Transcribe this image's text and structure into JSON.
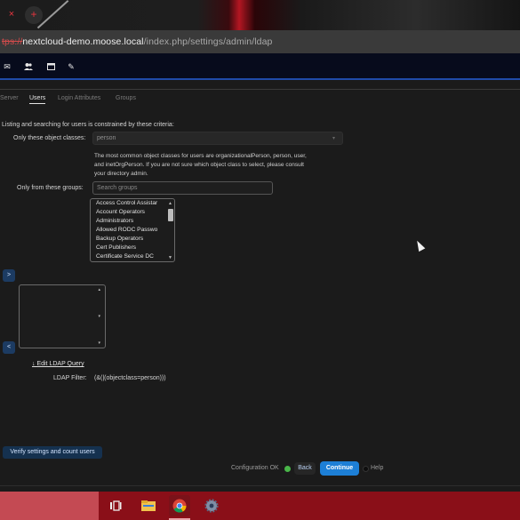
{
  "browser": {
    "url_scheme": "tps://",
    "url_host": "nextcloud-demo.moose.local",
    "url_path": "/index.php/settings/admin/ldap",
    "close_tab_glyph": "×",
    "new_tab_glyph": "+"
  },
  "header_icons": [
    "mail-icon",
    "contacts-icon",
    "calendar-icon",
    "pencil-icon"
  ],
  "tabs": [
    "Server",
    "Users",
    "Login Attributes",
    "Groups"
  ],
  "info_text": "Listing and searching for users is constrained by these criteria:",
  "object_classes": {
    "label": "Only these object classes:",
    "value": "person",
    "hint": "The most common object classes for users are organizationalPerson, person, user, and inetOrgPerson. If you are not sure which object class to select, please consult your directory admin."
  },
  "groups": {
    "label": "Only from these groups:",
    "search_placeholder": "Search groups",
    "available": [
      "Access Control Assistar",
      "Account Operators",
      "Administrators",
      "Allowed RODC Passwo",
      "Backup Operators",
      "Cert Publishers",
      "Certificate Service DC"
    ],
    "move_right": ">",
    "move_left": "<"
  },
  "ldap": {
    "edit_link": "↓ Edit LDAP Query",
    "filter_label": "LDAP Filter:",
    "filter_value": "(&(|(objectclass=person)))"
  },
  "verify_button": "Verify settings and count users",
  "footer": {
    "status": "Configuration OK",
    "status_color": "#49b649",
    "back": "Back",
    "continue": "Continue",
    "help": "Help"
  },
  "colors": {
    "accent": "#1d7fd6",
    "taskbar": "#8a0f18"
  },
  "taskbar_icons": [
    "task-view-icon",
    "file-explorer-icon",
    "chrome-icon",
    "settings-gear-icon"
  ]
}
